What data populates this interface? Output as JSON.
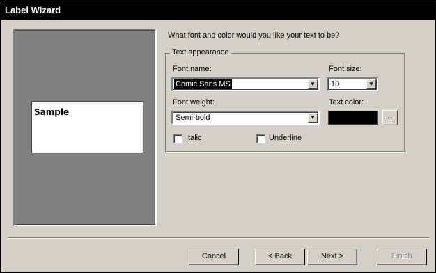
{
  "window": {
    "title": "Label Wizard"
  },
  "preview": {
    "sample_text": "Sample"
  },
  "question": "What font and color would you like your text to be?",
  "text_appearance": {
    "group_label": "Text appearance",
    "font_name": {
      "label": "Font name:",
      "value": "Comic Sans MS"
    },
    "font_size": {
      "label": "Font size:",
      "value": "10"
    },
    "font_weight": {
      "label": "Font weight:",
      "value": "Semi-bold"
    },
    "text_color": {
      "label": "Text color:",
      "color": "#000000",
      "button_label": "..."
    },
    "italic": {
      "label": "Italic",
      "checked": false
    },
    "underline": {
      "label": "Underline",
      "checked": false
    }
  },
  "buttons": {
    "cancel": "Cancel",
    "back": "< Back",
    "next": "Next >",
    "finish": "Finish"
  },
  "icons": {
    "dropdown": "chevron-down-icon"
  }
}
